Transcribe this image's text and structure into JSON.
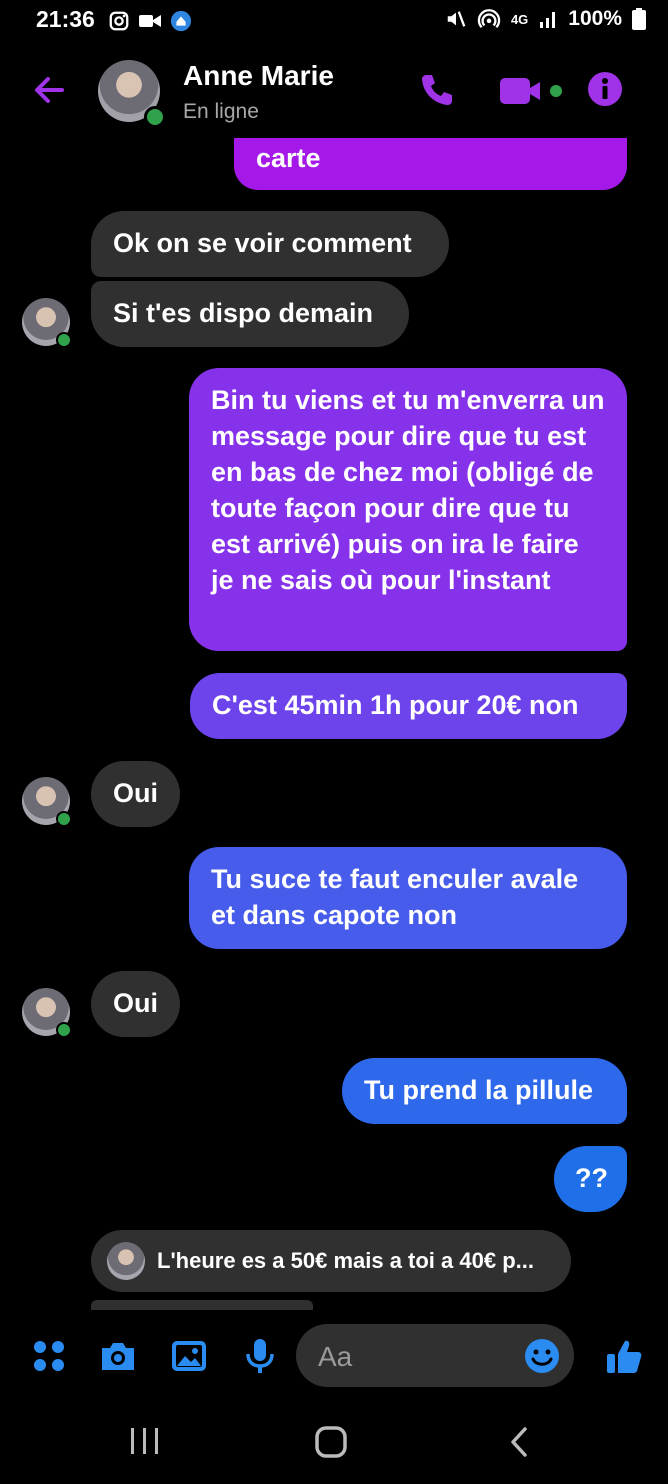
{
  "status_bar": {
    "time": "21:36",
    "network": "4G",
    "battery": "100%"
  },
  "header": {
    "name": "Anne Marie",
    "status": "En ligne",
    "accent": "#a033e8"
  },
  "messages": [
    {
      "dir": "out",
      "text": "carte"
    },
    {
      "dir": "in",
      "text": "Ok on se voir comment"
    },
    {
      "dir": "in",
      "text": "Si t'es dispo demain"
    },
    {
      "dir": "out",
      "text": "Bin tu viens et tu m'enverra un message pour dire que tu est en bas de chez moi (obligé de toute façon pour dire que tu est arrivé) puis on ira le faire je ne sais où pour l'instant"
    },
    {
      "dir": "out",
      "text": "C'est 45min 1h pour 20€ non"
    },
    {
      "dir": "in",
      "text": "Oui"
    },
    {
      "dir": "out",
      "text": "Tu suce te faut enculer avale et dans capote non"
    },
    {
      "dir": "in",
      "text": "Oui"
    },
    {
      "dir": "out",
      "text": "Tu prend la pillule"
    },
    {
      "dir": "out",
      "text": "??"
    }
  ],
  "reply_preview": {
    "text": "L'heure es a 50€ mais a toi a 40€ p..."
  },
  "composer": {
    "placeholder": "Aa"
  }
}
